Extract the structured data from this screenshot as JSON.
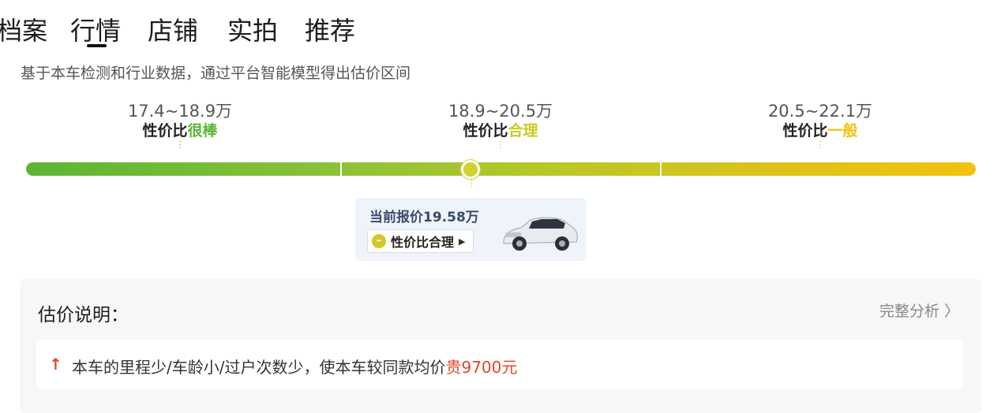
{
  "tabs": [
    {
      "label": "档案",
      "active": false
    },
    {
      "label": "行情",
      "active": true
    },
    {
      "label": "店铺",
      "active": false
    },
    {
      "label": "实拍",
      "active": false
    },
    {
      "label": "推荐",
      "active": false
    }
  ],
  "subtitle": "基于本车检测和行业数据，通过平台智能模型得出估价区间",
  "bands": [
    {
      "range": "17.4~18.9万",
      "prefix": "性价比",
      "level": "很棒",
      "color": "#5bb532"
    },
    {
      "range": "18.9~20.5万",
      "prefix": "性价比",
      "level": "合理",
      "color": "#c9cc20"
    },
    {
      "range": "20.5~22.1万",
      "prefix": "性价比",
      "level": "一般",
      "color": "#f3c20d"
    }
  ],
  "marker": {
    "value_wan": 19.58,
    "range_min": 17.4,
    "range_max": 22.1
  },
  "current": {
    "price_label": "当前报价19.58万",
    "verdict": "性价比合理",
    "verdict_icon": "neutral-face-icon",
    "arrow_icon": "play-arrow-icon"
  },
  "explain": {
    "title": "估价说明：",
    "full_link": "完整分析",
    "full_link_icon": "chevron-right-icon",
    "reason_icon": "up-arrow-icon",
    "reason_text": "本车的里程少/车龄小/过户次数少，使本车较同款均价",
    "reason_amount": "贵9700元",
    "accent_color": "#e0462b"
  }
}
